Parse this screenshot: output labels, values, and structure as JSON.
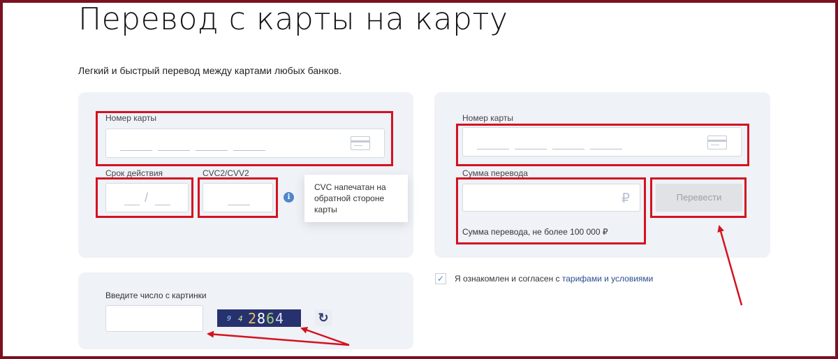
{
  "page": {
    "title": "Перевод с карты на карту",
    "subtitle": "Легкий и быстрый перевод между картами любых банков."
  },
  "sender": {
    "card_label": "Номер карты",
    "card_icon": "card-icon",
    "expiry_label": "Срок действия",
    "expiry_separator": "/",
    "cvc_label": "CVC2/CVV2",
    "info_icon": "info-icon",
    "cvc_tooltip": "CVC напечатан на обратной стороне карты"
  },
  "receiver": {
    "card_label": "Номер карты",
    "card_icon": "card-icon",
    "amount_label": "Сумма перевода",
    "currency_symbol": "₽",
    "amount_hint": "Сумма перевода, не более 100 000 ₽",
    "submit_label": "Перевести"
  },
  "captcha": {
    "label": "Введите число с картинки",
    "image_text": "9 4 2864",
    "refresh_icon": "refresh-icon"
  },
  "agreement": {
    "checked": true,
    "text": "Я ознакомлен и согласен с ",
    "link_text": "тарифами и условиями"
  },
  "colors": {
    "highlight": "#d4121f",
    "panel": "#eff2f7",
    "link": "#2a4d8f",
    "frame": "#7a1020"
  }
}
